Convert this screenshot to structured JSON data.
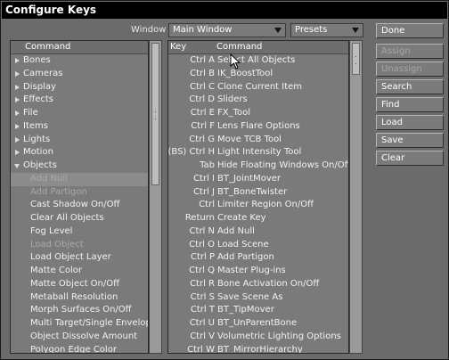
{
  "title": "Configure Keys",
  "window_label": "Window",
  "window_value": "Main Window",
  "presets_value": "Presets",
  "left_header": "Command",
  "left_items": [
    {
      "label": "Bones",
      "type": "group"
    },
    {
      "label": "Cameras",
      "type": "group"
    },
    {
      "label": "Display",
      "type": "group"
    },
    {
      "label": "Effects",
      "type": "group"
    },
    {
      "label": "File",
      "type": "group"
    },
    {
      "label": "Items",
      "type": "group"
    },
    {
      "label": "Lights",
      "type": "group"
    },
    {
      "label": "Motion",
      "type": "group"
    },
    {
      "label": "Objects",
      "type": "group-open"
    },
    {
      "label": "Add Null",
      "type": "child-selected"
    },
    {
      "label": "Add Partigon",
      "type": "child-disabled"
    },
    {
      "label": "Cast Shadow On/Off",
      "type": "child"
    },
    {
      "label": "Clear All Objects",
      "type": "child"
    },
    {
      "label": "Fog Level",
      "type": "child"
    },
    {
      "label": "Load Object",
      "type": "child-disabled"
    },
    {
      "label": "Load Object Layer",
      "type": "child"
    },
    {
      "label": "Matte Color",
      "type": "child"
    },
    {
      "label": "Matte Object On/Off",
      "type": "child"
    },
    {
      "label": "Metaball Resolution",
      "type": "child"
    },
    {
      "label": "Morph Surfaces On/Off",
      "type": "child"
    },
    {
      "label": "Multi Target/Single Envelop...",
      "type": "child"
    },
    {
      "label": "Object Dissolve Amount",
      "type": "child"
    },
    {
      "label": "Polygon Edge Color",
      "type": "child"
    }
  ],
  "mid_header": {
    "key": "Key",
    "command": "Command"
  },
  "key_rows": [
    {
      "key": "Ctrl A",
      "command": "Select All Objects"
    },
    {
      "key": "Ctrl B",
      "command": "IK_BoostTool"
    },
    {
      "key": "Ctrl C",
      "command": "Clone Current Item"
    },
    {
      "key": "Ctrl D",
      "command": "Sliders"
    },
    {
      "key": "Ctrl E",
      "command": "FX_Tool"
    },
    {
      "key": "Ctrl F",
      "command": "Lens Flare Options"
    },
    {
      "key": "Ctrl G",
      "command": "Move TCB Tool"
    },
    {
      "key": "(BS) Ctrl H",
      "command": "Light Intensity Tool"
    },
    {
      "key": "Tab",
      "command": "Hide Floating Windows On/Off"
    },
    {
      "key": "Ctrl I",
      "command": "BT_JointMover"
    },
    {
      "key": "Ctrl J",
      "command": "BT_BoneTwister"
    },
    {
      "key": "Ctrl",
      "command": "Limiter Region On/Off"
    },
    {
      "key": "Return",
      "command": "Create Key"
    },
    {
      "key": "Ctrl N",
      "command": "Add Null"
    },
    {
      "key": "Ctrl O",
      "command": "Load Scene"
    },
    {
      "key": "Ctrl P",
      "command": "Add Partigon"
    },
    {
      "key": "Ctrl Q",
      "command": "Master Plug-ins"
    },
    {
      "key": "Ctrl R",
      "command": "Bone Activation On/Off"
    },
    {
      "key": "Ctrl S",
      "command": "Save Scene As"
    },
    {
      "key": "Ctrl T",
      "command": "BT_TipMover"
    },
    {
      "key": "Ctrl U",
      "command": "BT_UnParentBone"
    },
    {
      "key": "Ctrl V",
      "command": "Volumetric Lighting Options"
    },
    {
      "key": "Ctrl W",
      "command": "BT_MirrorHierarchy"
    }
  ],
  "buttons": [
    {
      "label": "Done",
      "enabled": true
    },
    {
      "label": "Assign",
      "enabled": false
    },
    {
      "label": "Unassign",
      "enabled": false
    },
    {
      "label": "Search",
      "enabled": true
    },
    {
      "label": "Find",
      "enabled": true
    },
    {
      "label": "Load",
      "enabled": true
    },
    {
      "label": "Save",
      "enabled": true
    },
    {
      "label": "Clear",
      "enabled": true
    }
  ]
}
